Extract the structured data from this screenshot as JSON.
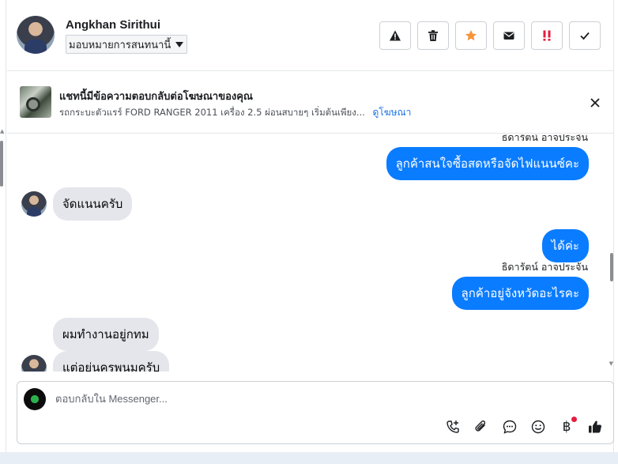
{
  "header": {
    "user_name": "Angkhan Sirithui",
    "assign_label": "มอบหมายการสนทนานี้",
    "actions": [
      {
        "name": "report-icon",
        "color": "#1c1e21"
      },
      {
        "name": "trash-icon",
        "color": "#1c1e21"
      },
      {
        "name": "star-icon",
        "color": "#f7923b"
      },
      {
        "name": "mail-icon",
        "color": "#1c1e21"
      },
      {
        "name": "urgent-icon",
        "color": "#e41e3f"
      },
      {
        "name": "check-icon",
        "color": "#1c1e21"
      }
    ]
  },
  "ad_banner": {
    "title": "แชทนี้มีข้อความตอบกลับต่อโฆษณาของคุณ",
    "description": "รถกระบะตัวแรร์ FORD RANGER 2011 เครื่อง 2.5 ผ่อนสบายๆ เริ่มต้นเพียง...",
    "link": "ดูโฆษณา",
    "close_icon": "close-icon"
  },
  "messages": [
    {
      "direction": "out",
      "sender": "ธิดารัตน์ อาจประจัน",
      "text": "ลูกค้าสนใจซื้อสดหรือจัดไฟแนนซ์คะ"
    },
    {
      "direction": "in",
      "text": "จัดแนนครับ"
    },
    {
      "direction": "out",
      "text": "ได้ค่ะ"
    },
    {
      "direction": "out",
      "sender": "ธิดารัตน์ อาจประจัน",
      "text": "ลูกค้าอยู่จังหวัดอะไรคะ"
    },
    {
      "direction": "in",
      "text": "ผมทำงานอยู่กทม"
    },
    {
      "direction": "in",
      "text": "แต่อยู่นครพนมครับ"
    }
  ],
  "composer": {
    "placeholder": "ตอบกลับใน Messenger...",
    "tools": [
      "phone-add-icon",
      "attachment-icon",
      "saved-reply-icon",
      "emoji-icon",
      "baht-payment-icon",
      "thumbs-up-icon"
    ],
    "baht_symbol": "฿",
    "accent": "#1877f2"
  }
}
